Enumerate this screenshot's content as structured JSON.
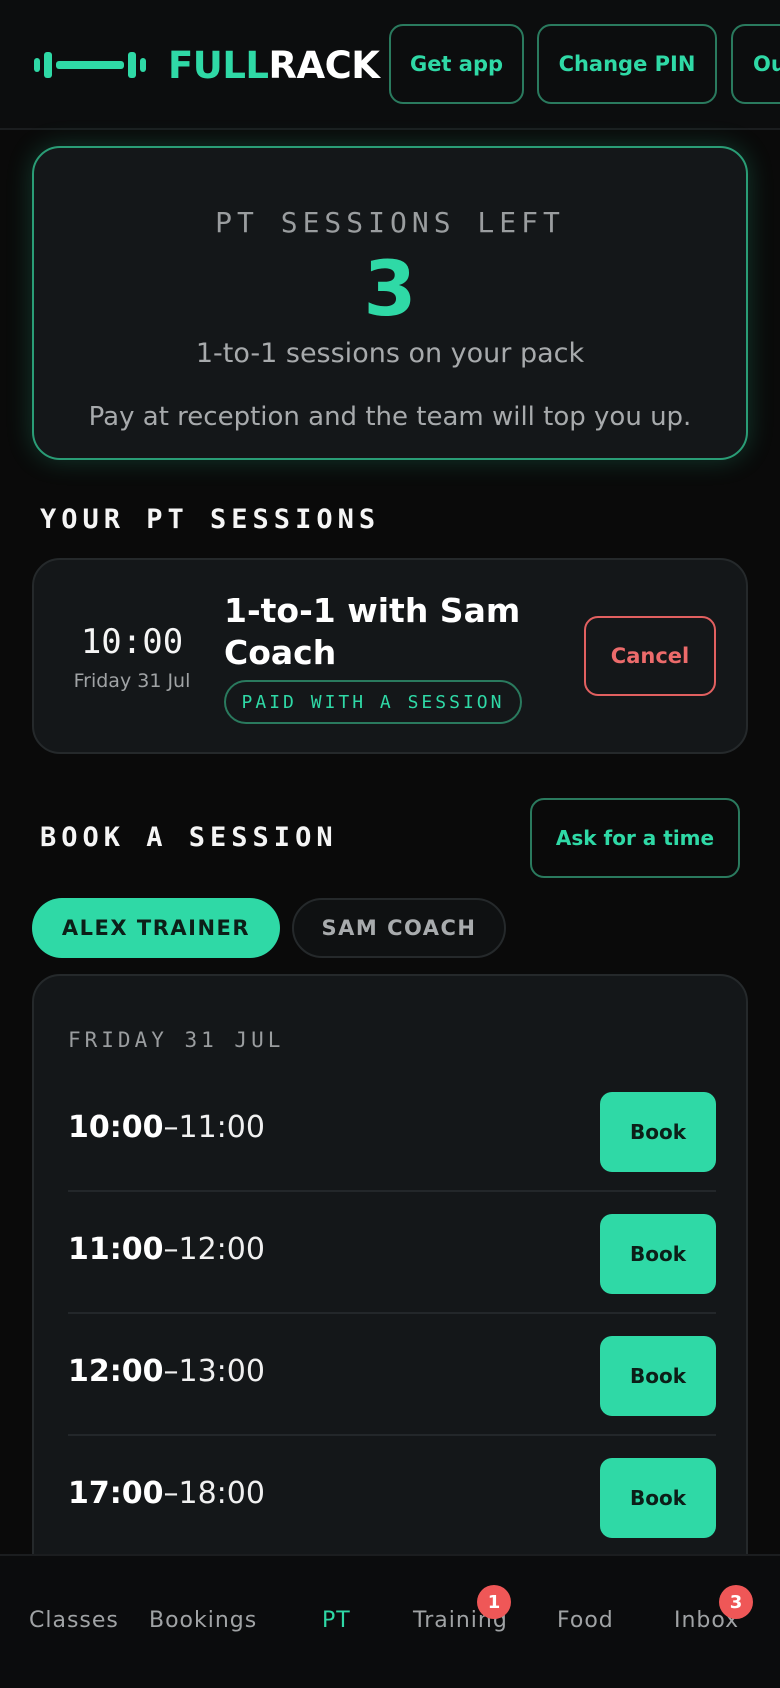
{
  "header": {
    "logo": {
      "part1": "FULL",
      "part2": "RACK"
    },
    "buttons": {
      "get_app": "Get app",
      "change_pin": "Change PIN",
      "out": "Ou"
    }
  },
  "summary": {
    "label": "PT SESSIONS LEFT",
    "count": "3",
    "subtitle": "1-to-1 sessions on your pack",
    "note": "Pay at reception and the team will top you up."
  },
  "your_sessions": {
    "title": "YOUR PT SESSIONS",
    "items": [
      {
        "time": "10:00",
        "date": "Friday 31 Jul",
        "title": "1-to-1 with Sam Coach",
        "badge": "PAID WITH A SESSION",
        "cancel": "Cancel"
      }
    ]
  },
  "book": {
    "title": "BOOK A SESSION",
    "ask_label": "Ask for a time",
    "trainers": [
      {
        "label": "ALEX TRAINER",
        "active": true
      },
      {
        "label": "SAM COACH",
        "active": false
      }
    ],
    "day": "FRIDAY 31 JUL",
    "slots": [
      {
        "start": "10:00",
        "end": "–11:00",
        "book": "Book"
      },
      {
        "start": "11:00",
        "end": "–12:00",
        "book": "Book"
      },
      {
        "start": "12:00",
        "end": "–13:00",
        "book": "Book"
      },
      {
        "start": "17:00",
        "end": "–18:00",
        "book": "Book"
      }
    ]
  },
  "nav": {
    "items": [
      {
        "label": "Classes",
        "active": false
      },
      {
        "label": "Bookings",
        "active": false
      },
      {
        "label": "PT",
        "active": true
      },
      {
        "label": "Training",
        "active": false,
        "badge": "1"
      },
      {
        "label": "Food",
        "active": false
      },
      {
        "label": "Inbox",
        "active": false,
        "badge": "3"
      }
    ]
  },
  "colors": {
    "accent": "#2fd9a6",
    "danger": "#ec6b6b",
    "background": "#0a0a0a",
    "card": "#141719"
  }
}
